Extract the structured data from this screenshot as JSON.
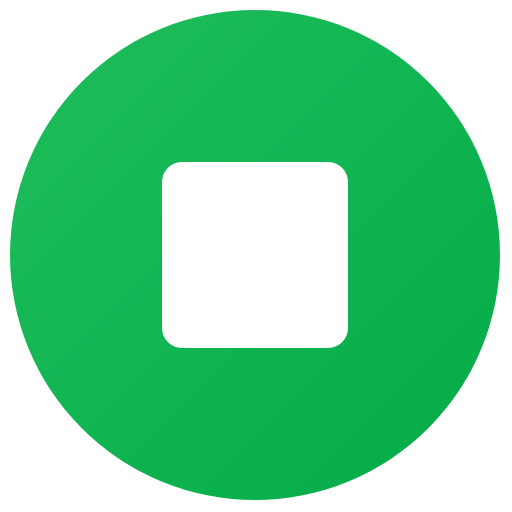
{
  "stop_button": {
    "icon": "stop-icon",
    "colors": {
      "circle_start": "#1fbd5a",
      "circle_end": "#03ab45",
      "square": "#ffffff",
      "background": "#ffffff"
    }
  }
}
